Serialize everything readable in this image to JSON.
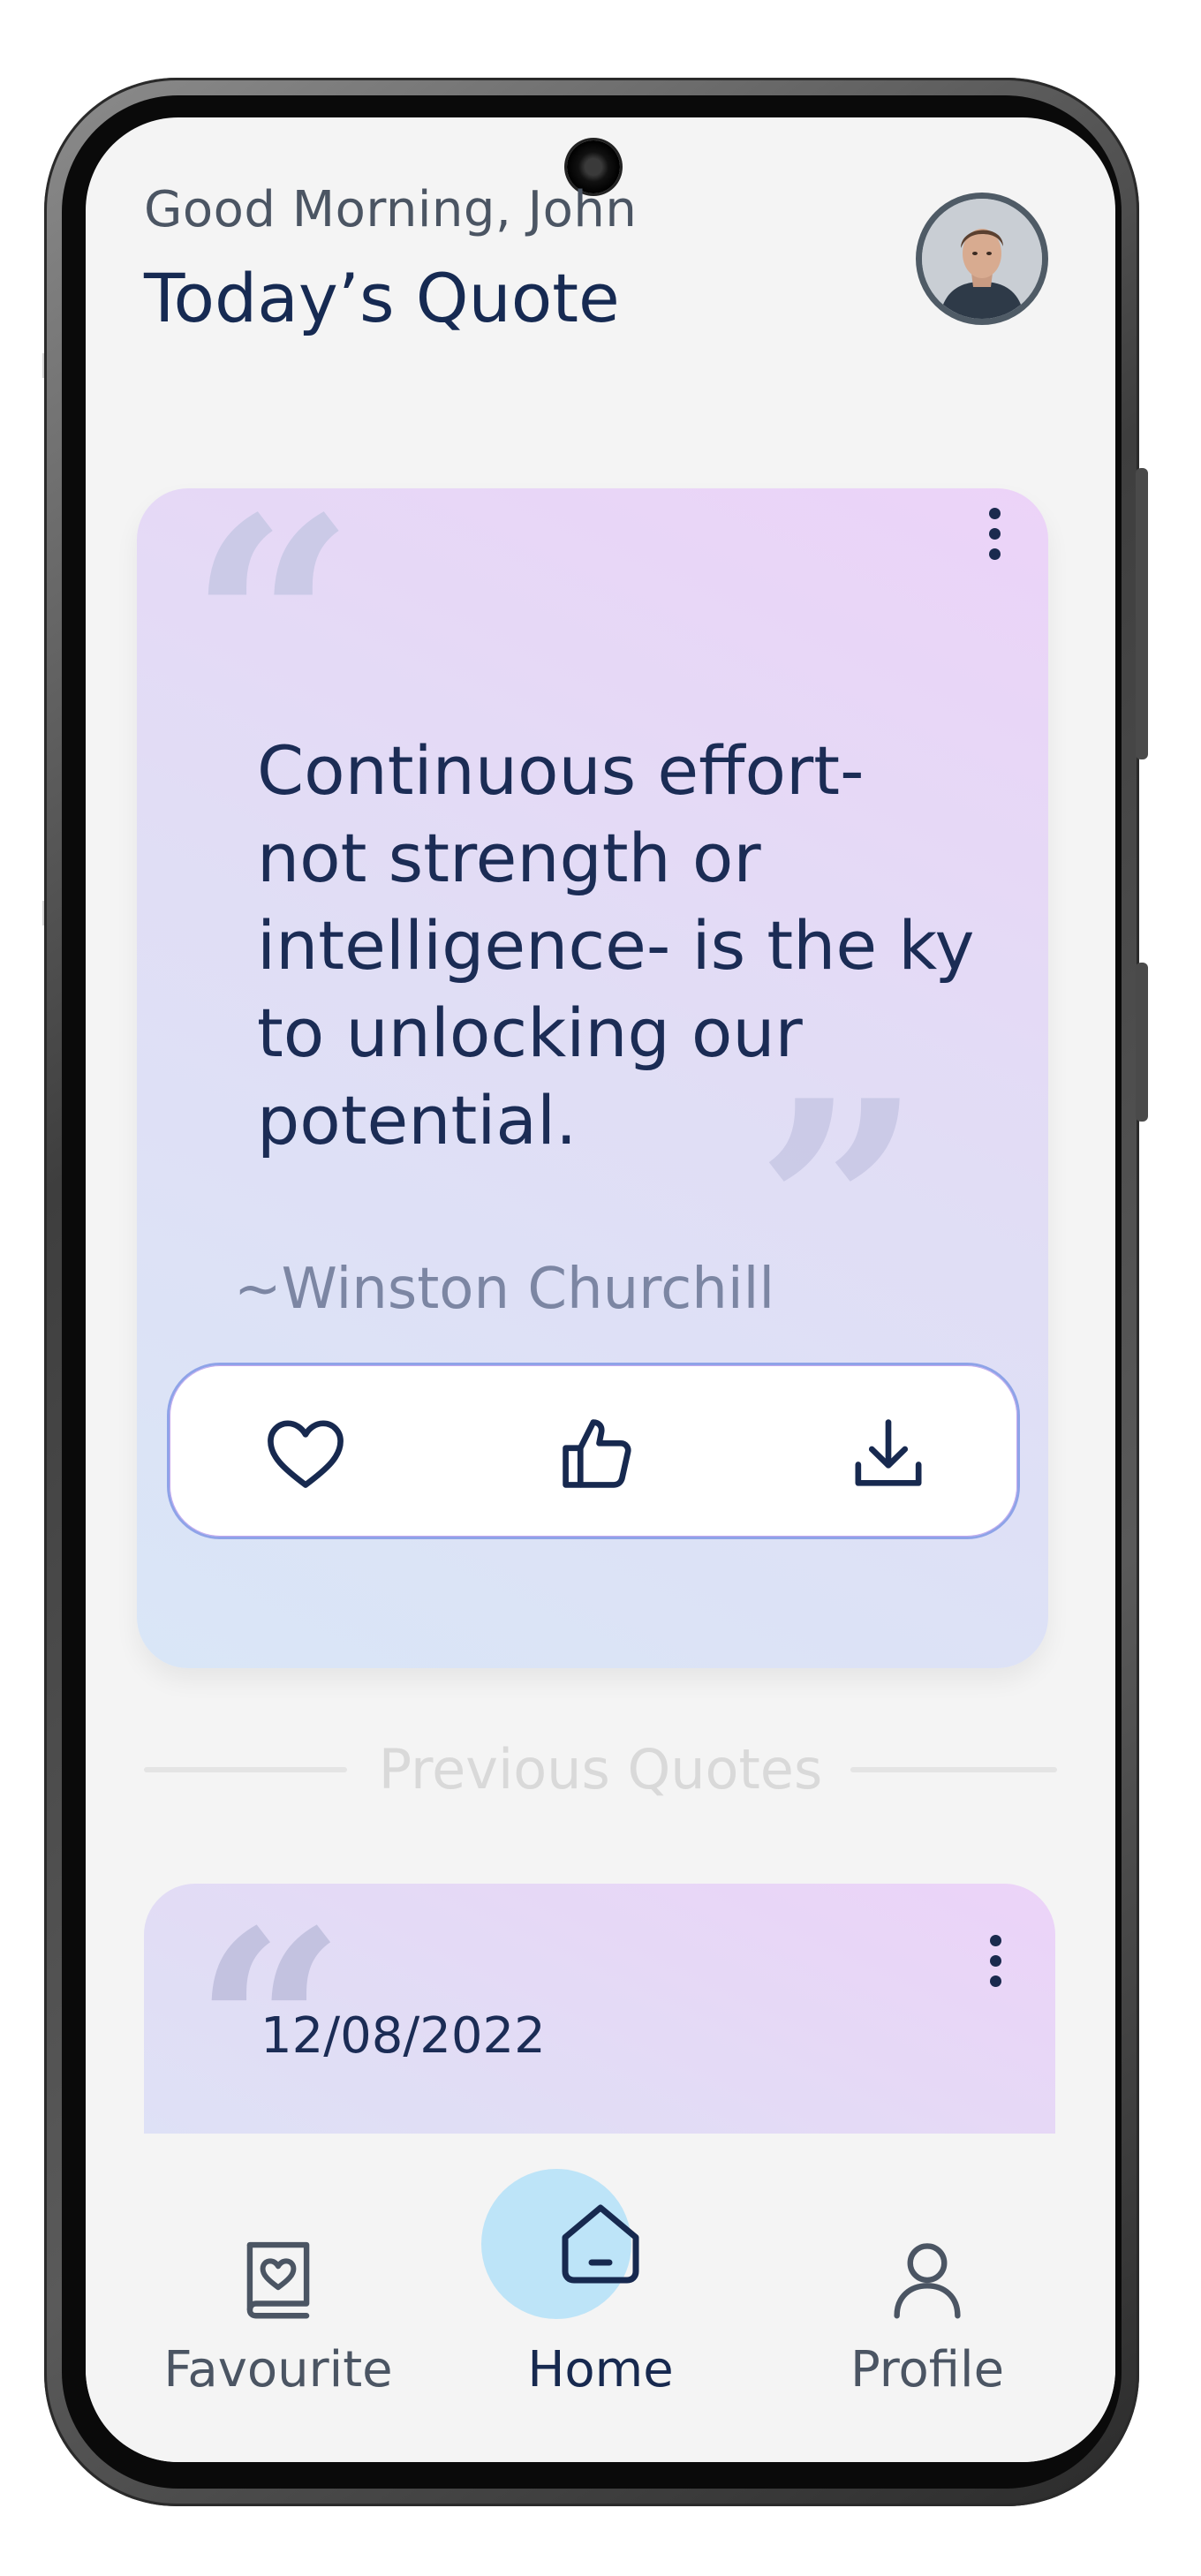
{
  "header": {
    "greeting": "Good Morning, John",
    "title": "Today’s Quote"
  },
  "quote": {
    "text": "Continuous effort- not strength or intelligence- is the ky to unlocking our potential.",
    "author": "~Winston Churchill",
    "actions": [
      {
        "icon": "heart-icon"
      },
      {
        "icon": "thumbs-up-icon"
      },
      {
        "icon": "download-icon"
      }
    ]
  },
  "previous": {
    "section_label": "Previous Quotes",
    "items": [
      {
        "date": "12/08/2022"
      }
    ]
  },
  "nav": {
    "items": [
      {
        "label": "Favourite",
        "icon": "book-heart-icon"
      },
      {
        "label": "Home",
        "icon": "home-icon",
        "active": true
      },
      {
        "label": "Profile",
        "icon": "user-icon"
      }
    ]
  },
  "colors": {
    "primary_text": "#162a52",
    "secondary_text": "#4b5563",
    "home_highlight": "#bde4f8",
    "card_gradient_start": "#ecd3f8",
    "card_gradient_end": "#d9e6f7"
  }
}
